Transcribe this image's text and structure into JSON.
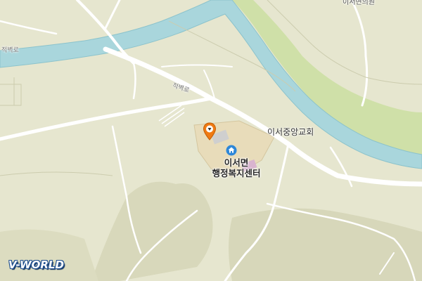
{
  "map": {
    "labels": {
      "road_left": "적벽로",
      "road_center": "적벽로",
      "church": "이서중앙교회",
      "office_line1": "이서면",
      "office_line2": "행정복지센터",
      "top_right": "이서면의원"
    },
    "colors": {
      "land": "#e6e6cf",
      "river": "#a9d6dc",
      "river_edge": "#8cc3cc",
      "riverbank": "#cfe0a8",
      "road": "#ffffff",
      "hill": "#d9d9bd",
      "facility": "#e8dcba",
      "marker": "#f07a12",
      "home_icon": "#2d87d8",
      "pink_building": "#d9b4cf"
    },
    "icons": {
      "marker": "location-pin-icon",
      "office": "home-icon"
    }
  },
  "logo": {
    "text": "V-WORLD"
  }
}
